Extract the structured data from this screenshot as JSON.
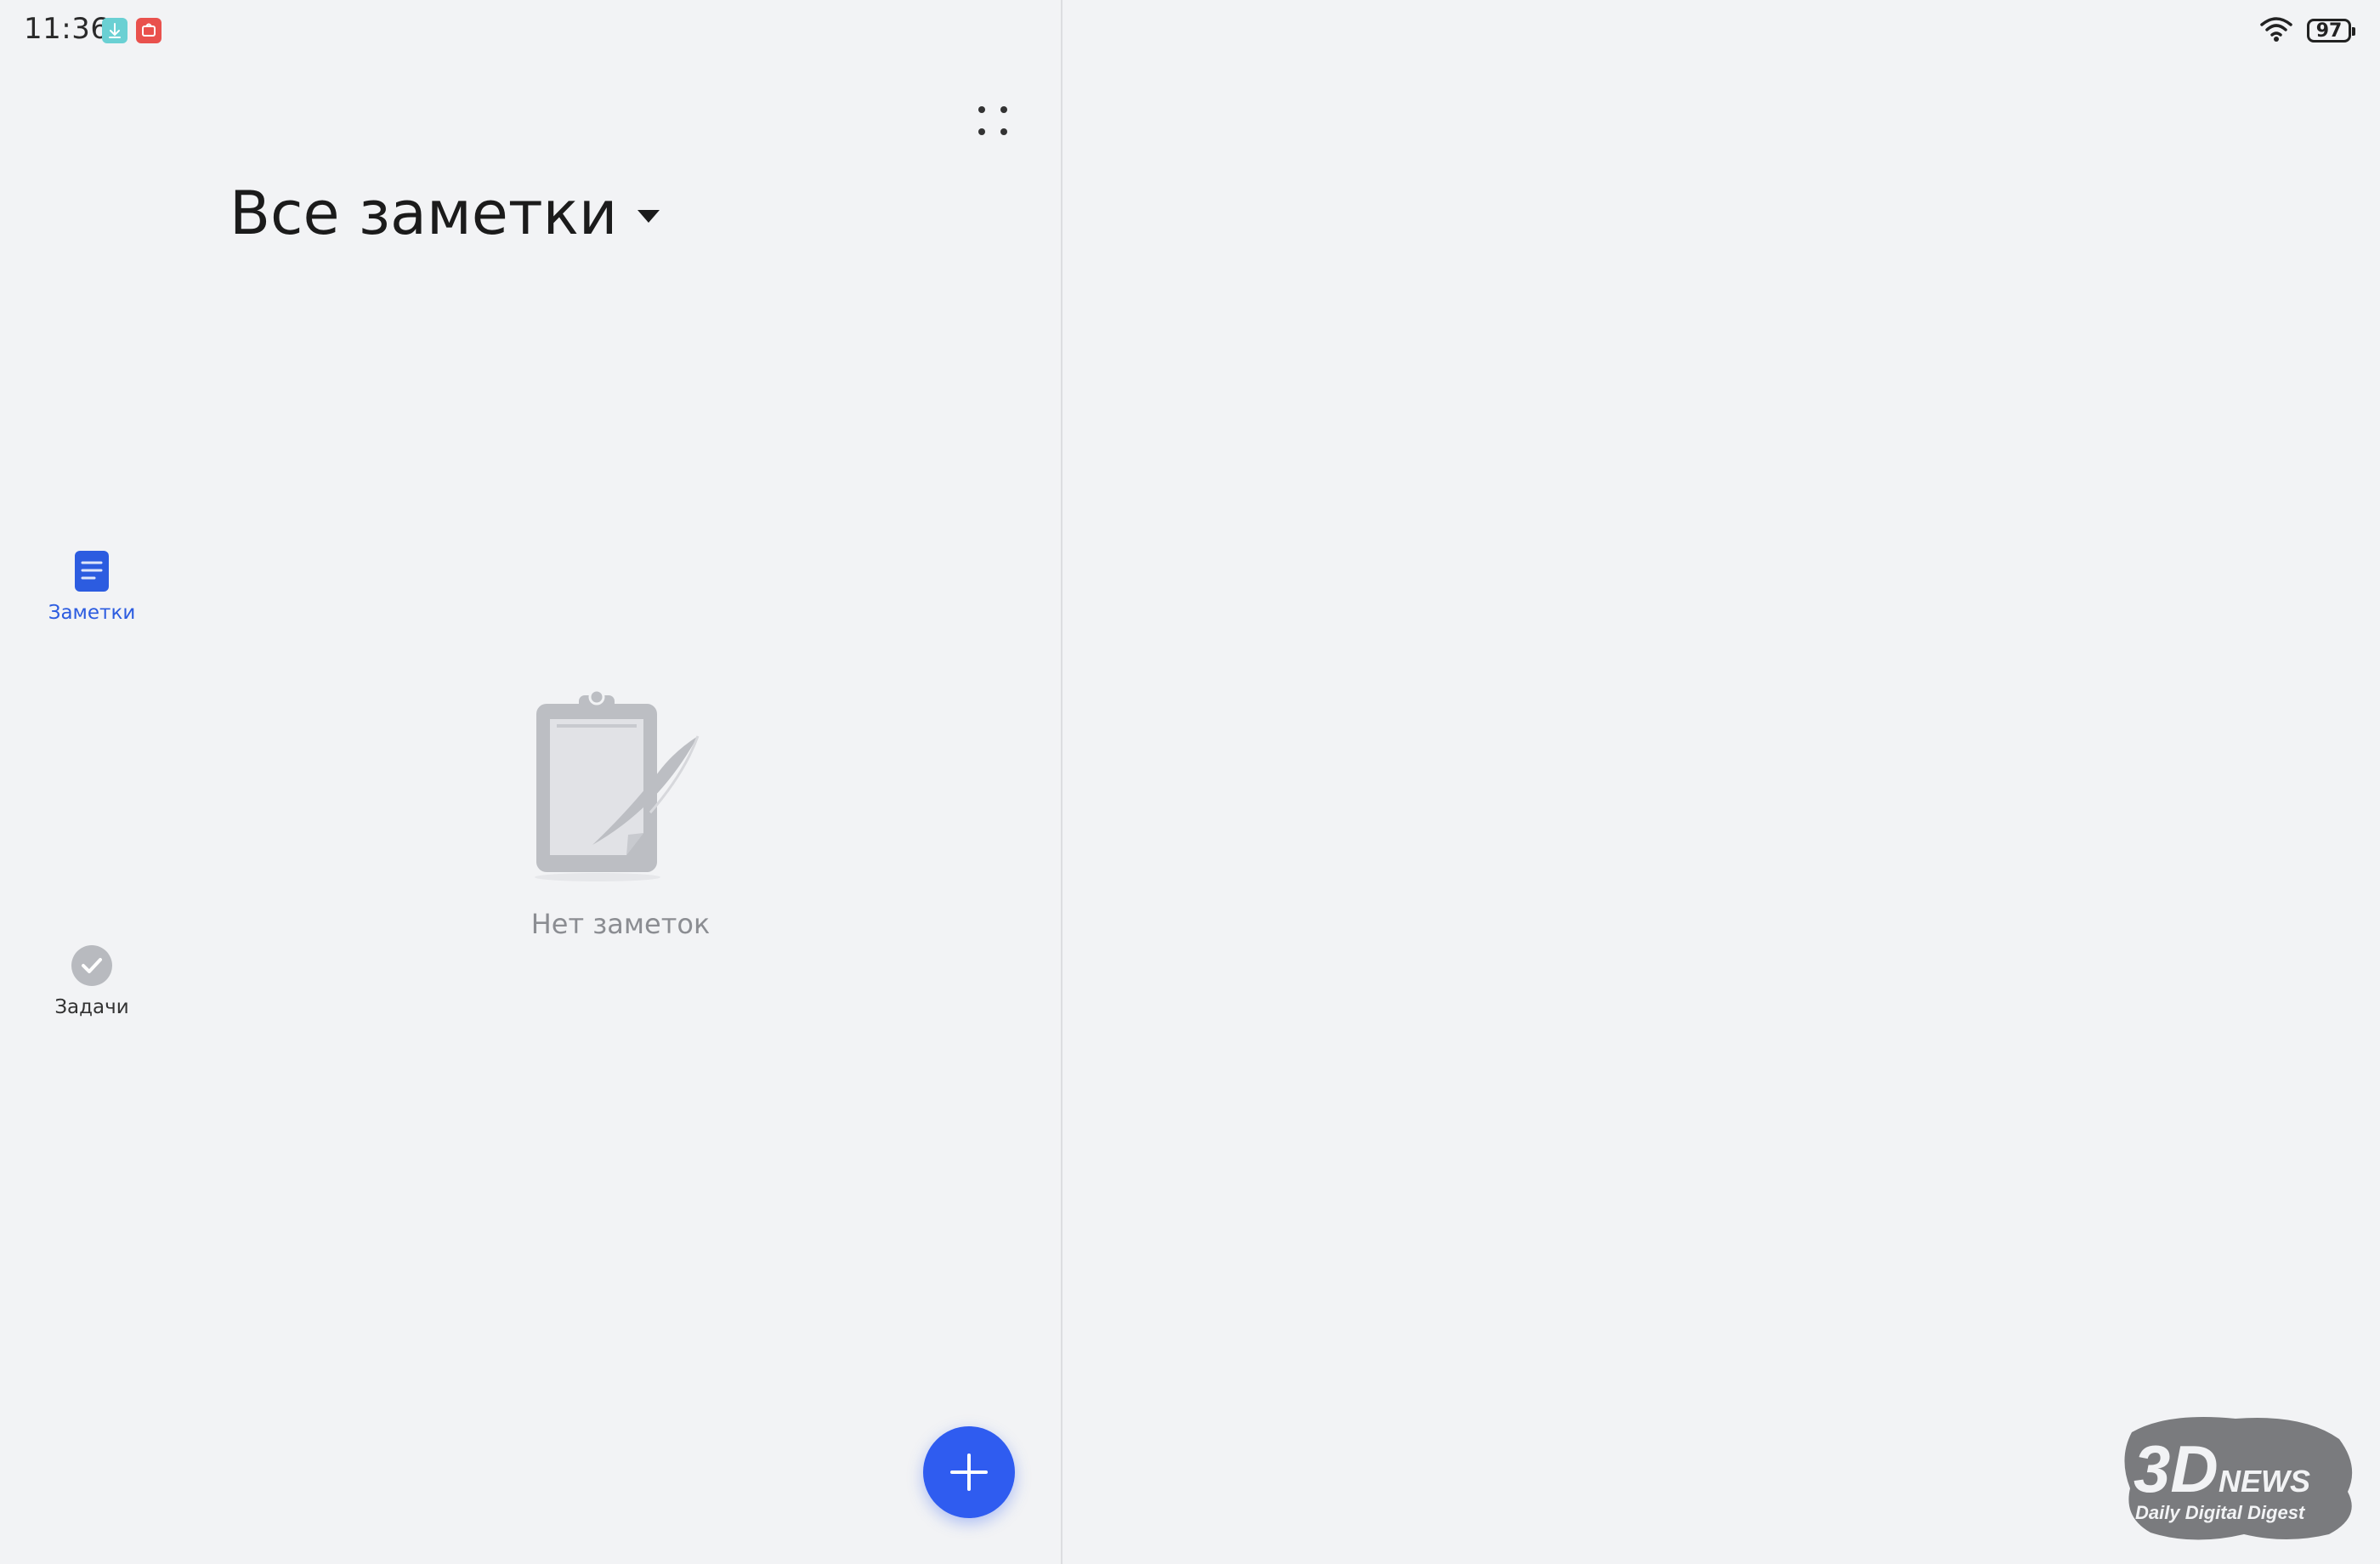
{
  "status_bar": {
    "time": "11:36",
    "battery_level": "97",
    "app_icons": [
      "download-app-icon",
      "huawei-app-icon"
    ]
  },
  "header": {
    "title": "Все заметки"
  },
  "nav": {
    "items": [
      {
        "label": "Заметки",
        "icon": "notes-icon",
        "active": true
      },
      {
        "label": "Задачи",
        "icon": "tasks-check-icon",
        "active": false
      }
    ]
  },
  "empty_state": {
    "text": "Нет заметок",
    "icon": "clipboard-pen-icon"
  },
  "fab": {
    "icon": "plus-icon"
  },
  "watermark": {
    "brand": "3DNEWS",
    "tagline": "Daily Digital Digest"
  },
  "colors": {
    "background": "#f2f3f5",
    "accent": "#2f5cf0",
    "active_nav": "#2c5ce0",
    "muted_text": "#8b8d92"
  }
}
